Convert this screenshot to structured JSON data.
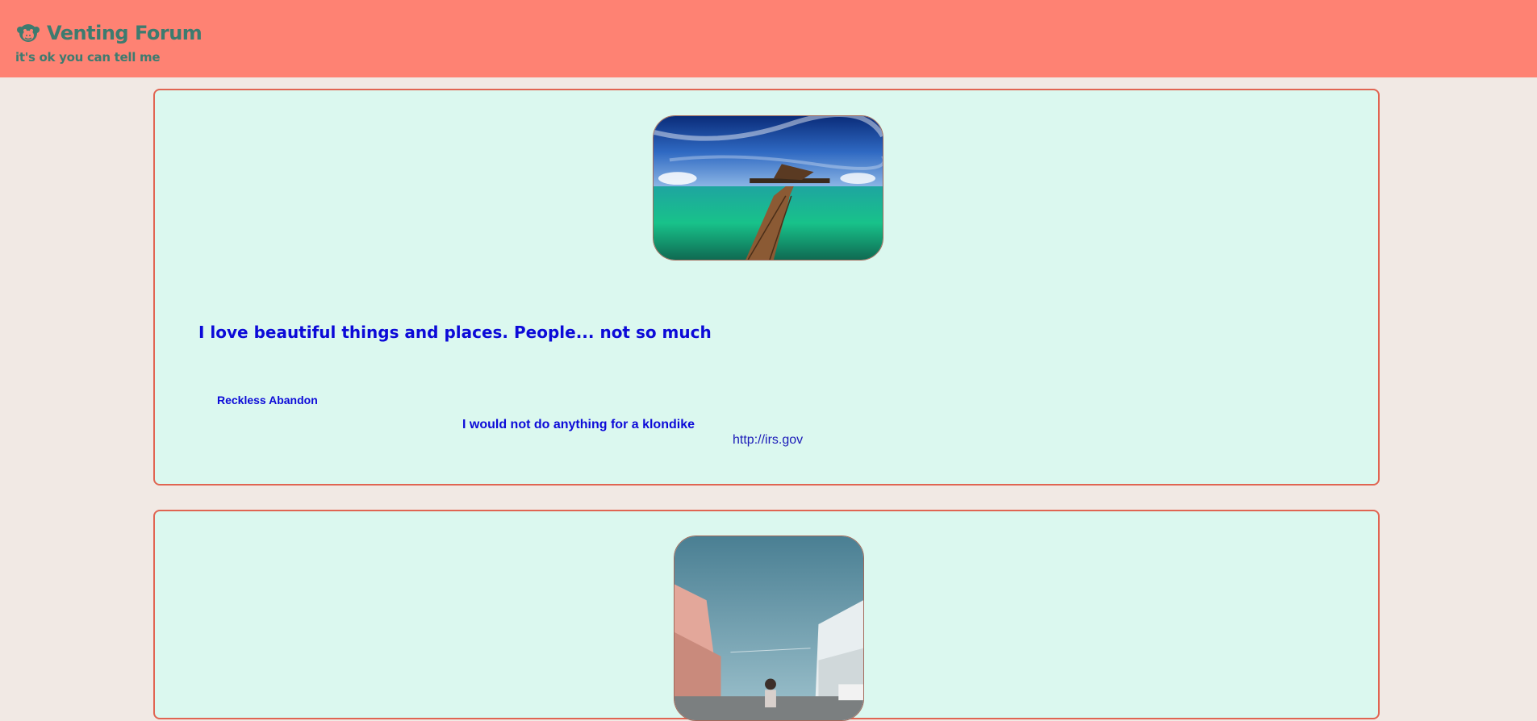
{
  "header": {
    "title": "Venting Forum",
    "tagline": "it's ok you can tell me",
    "logo_icon": "monkey-face-icon"
  },
  "colors": {
    "header_bg": "#fe8273",
    "brand_text": "#3d7b6f",
    "page_bg": "#f1e9e4",
    "card_bg": "#dbf8ef",
    "card_border": "#e06552",
    "post_text": "#0c0ad8"
  },
  "posts": [
    {
      "image": "overwater-bungalow-boardwalk-photo",
      "title": "I love beautiful things and places. People... not so much",
      "author": "Reckless Abandon",
      "body": "I would not do anything for a klondike",
      "link": "http://irs.gov"
    },
    {
      "image": "street-skateboarder-photo"
    }
  ]
}
